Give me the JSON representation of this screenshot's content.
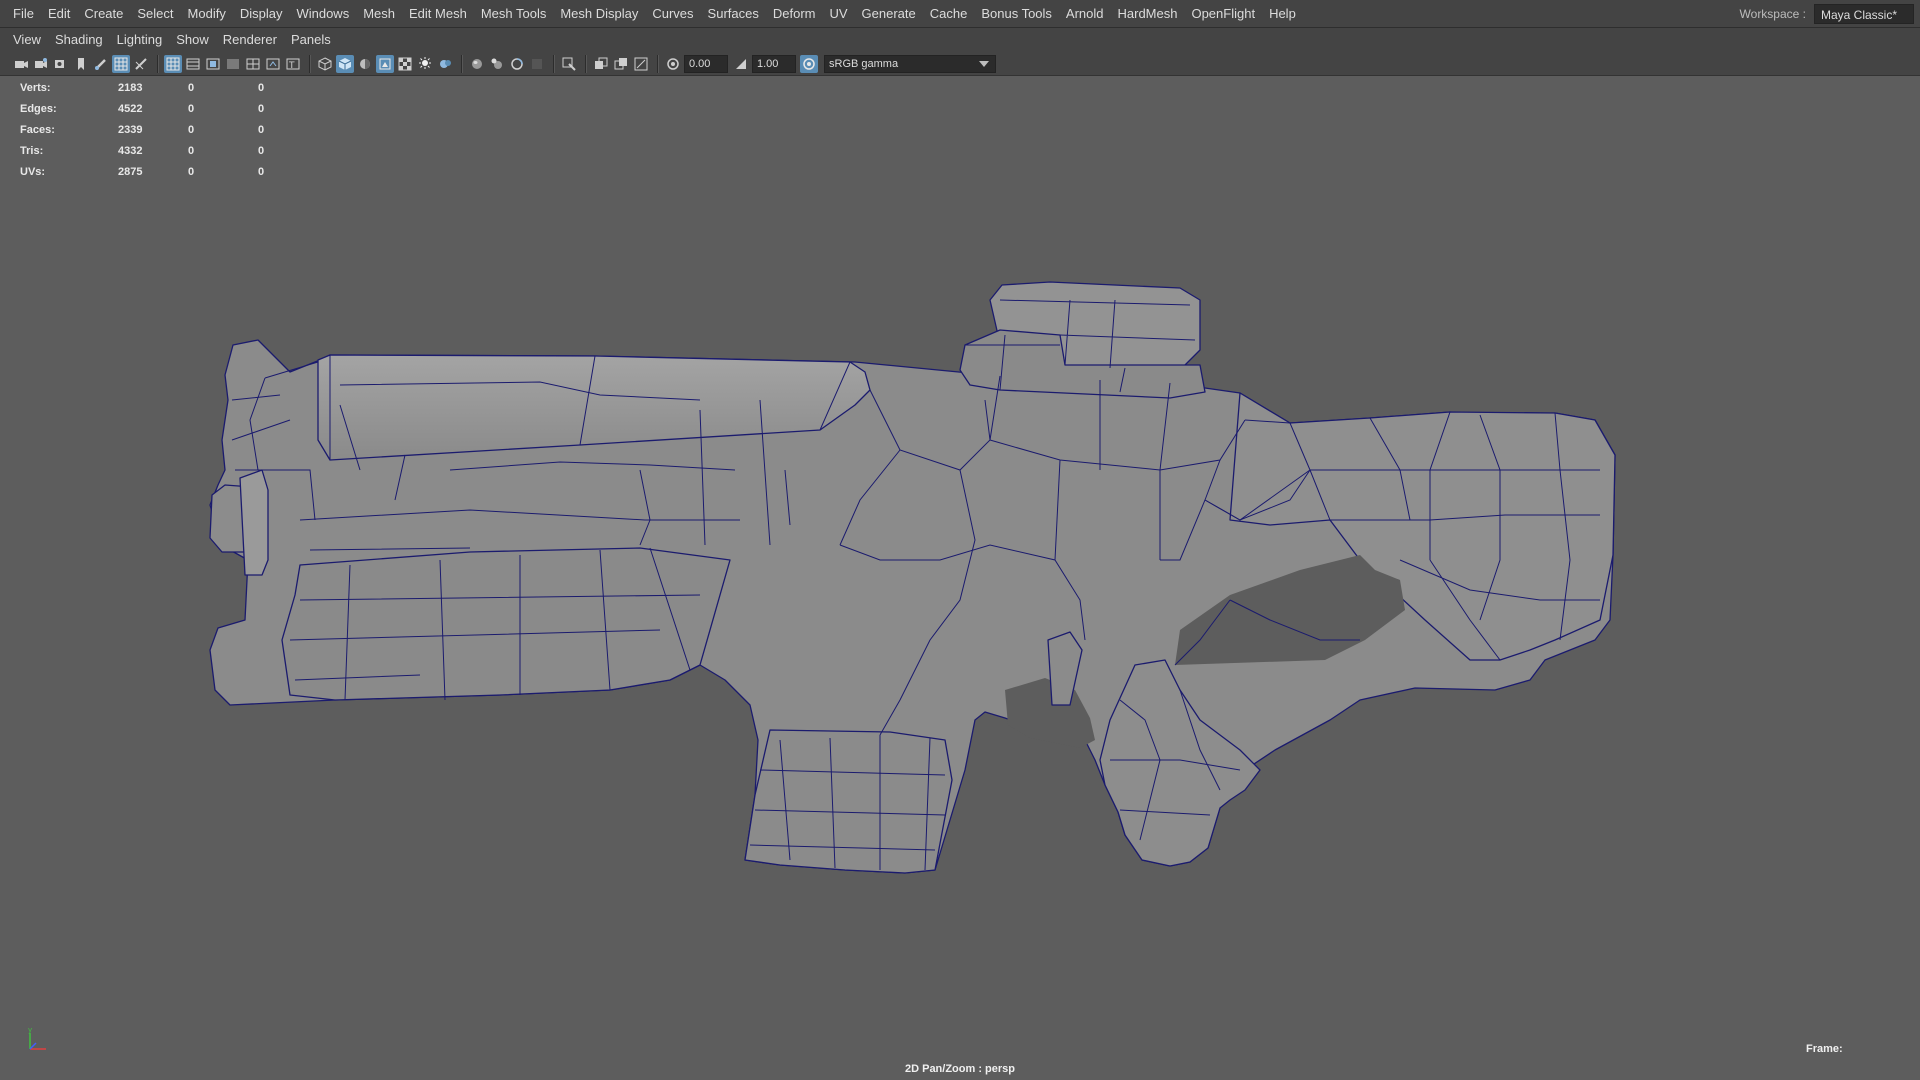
{
  "menubar": {
    "items": [
      "File",
      "Edit",
      "Create",
      "Select",
      "Modify",
      "Display",
      "Windows",
      "Mesh",
      "Edit Mesh",
      "Mesh Tools",
      "Mesh Display",
      "Curves",
      "Surfaces",
      "Deform",
      "UV",
      "Generate",
      "Cache",
      "Bonus Tools",
      "Arnold",
      "HardMesh",
      "OpenFlight",
      "Help"
    ]
  },
  "workspace": {
    "label": "Workspace :",
    "value": "Maya Classic*"
  },
  "panel_menu": {
    "items": [
      "View",
      "Shading",
      "Lighting",
      "Show",
      "Renderer",
      "Panels"
    ]
  },
  "toolbar": {
    "exposure": "0.00",
    "gamma": "1.00",
    "color_space": "sRGB gamma",
    "icons": [
      "camera-select-icon",
      "camera-attributes-icon",
      "bookmark-icon",
      "image-plane-icon",
      "grease-pencil-icon",
      "grid-icon",
      "film-gate-icon",
      "resolution-gate-icon",
      "gate-mask-icon",
      "field-chart-icon",
      "safe-action-icon",
      "safe-title-icon",
      "wireframe-icon",
      "smooth-shade-icon",
      "default-material-icon",
      "wireframe-on-shaded-icon",
      "xray-icon",
      "use-all-lights-icon",
      "shadows-icon",
      "ambient-occlusion-icon",
      "motion-blur-icon",
      "anti-alias-icon",
      "isolate-select-icon",
      "xray-joints-icon",
      "xray-active-icon",
      "textured-icon",
      "exposure-icon",
      "gamma-icon",
      "color-management-icon"
    ]
  },
  "hud": {
    "rows": [
      {
        "label": "Verts:",
        "c1": "2183",
        "c2": "0",
        "c3": "0"
      },
      {
        "label": "Edges:",
        "c1": "4522",
        "c2": "0",
        "c3": "0"
      },
      {
        "label": "Faces:",
        "c1": "2339",
        "c2": "0",
        "c3": "0"
      },
      {
        "label": "Tris:",
        "c1": "4332",
        "c2": "0",
        "c3": "0"
      },
      {
        "label": "UVs:",
        "c1": "2875",
        "c2": "0",
        "c3": "0"
      }
    ],
    "camera": "2D Pan/Zoom : persp",
    "frame_label": "Frame:"
  },
  "colors": {
    "background": "#5d5d5d",
    "menubar": "#444444",
    "model_fill": "#8c8c8c",
    "wire": "#1a1a6e",
    "active_icon": "#5a8db5"
  },
  "axis_gizmo": {
    "y_label": "y"
  }
}
